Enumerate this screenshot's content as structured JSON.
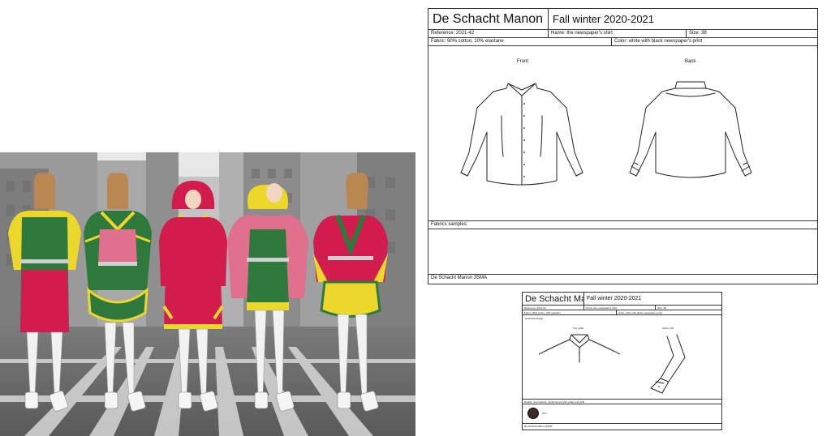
{
  "sheet_main": {
    "brand": "De Schacht Manon",
    "season": "Fall winter 2020-2021",
    "reference": "Reference: 2021-42",
    "name": "Name: the newspaper's shirt",
    "size": "Size: 38",
    "fabric": "Fabric: 90% cotton, 10% elastane",
    "color": "Color: white with black newspaper's print",
    "front_label": "Front",
    "back_label": "Back",
    "fabric_samples": "Fabrics samples:",
    "footer": "De Schacht Manon 3SMA"
  },
  "sheet_detail": {
    "brand": "De Schacht Manon",
    "season": "Fall winter 2020-2021",
    "reference": "Reference: 2021-42",
    "name": "Name: the newspaper's shirt",
    "size": "Size: 38",
    "fabric": "Fabric: 90% cotton, 10% elastane",
    "color": "Color: white with black newspaper's print",
    "technical_design": "Technical design:",
    "collar_label": "The collar",
    "cuff_label": "Shirt's cuff",
    "details": "Details: nine buttons, reinforcement thru collar and cuffs",
    "button_size": "1cm",
    "footer": "De Schacht Manon 3SMA"
  },
  "palette": {
    "red": "#d21c4e",
    "green": "#2e7a3d",
    "yellow": "#ecd72a",
    "pink": "#e0708e",
    "street_gray": "#8a8a8a"
  }
}
